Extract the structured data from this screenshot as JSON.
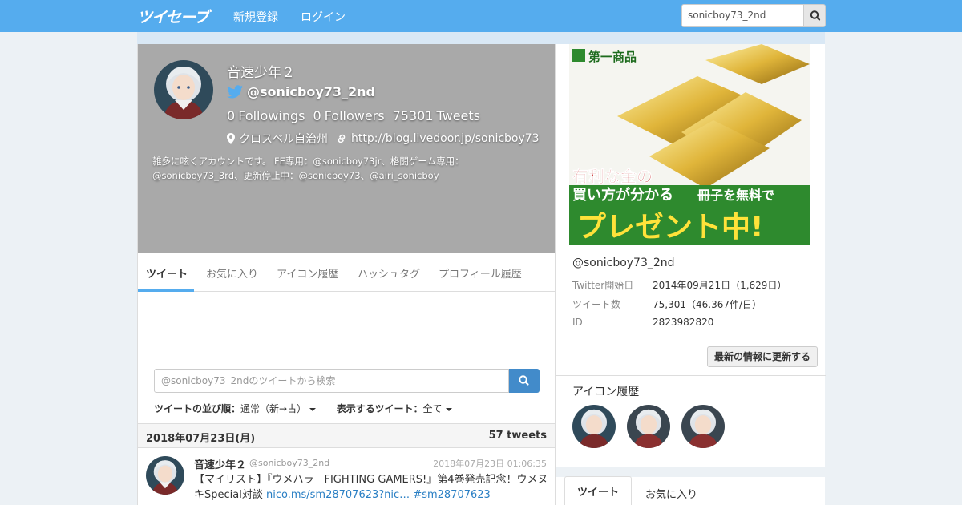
{
  "nav": {
    "logo": "ツイセーブ",
    "register": "新規登録",
    "login": "ログイン",
    "search_value": "sonicboy73_2nd"
  },
  "profile": {
    "name": "音速少年２",
    "handle": "@sonicboy73_2nd",
    "followings_count": "0",
    "followings_label": "Followings",
    "followers_count": "0",
    "followers_label": "Followers",
    "tweets_count": "75301",
    "tweets_label": "Tweets",
    "location": "クロスベル自治州",
    "url": "http://blog.livedoor.jp/sonicboy73",
    "bio": "雑多に呟くアカウントです。 FE専用：@sonicboy73jr、格闘ゲーム専用：@sonicboy73_3rd、更新停止中：@sonicboy73、@airi_sonicboy"
  },
  "tabs": [
    "ツイート",
    "お気に入り",
    "アイコン履歴",
    "ハッシュタグ",
    "プロフィール履歴"
  ],
  "tweet_search": {
    "placeholder": "@sonicboy73_2ndのツイートから検索"
  },
  "sort": {
    "order_label": "ツイートの並び順：",
    "order_value": "通常（新→古）",
    "show_label": "表示するツイート：",
    "show_value": "全て"
  },
  "day": {
    "date": "2018年07月23日(月)",
    "count": "57 tweets"
  },
  "tweet": {
    "name": "音速少年２",
    "handle": "@sonicboy73_2nd",
    "time": "2018年07月23日 01:06:35",
    "text": "【マイリスト】『ウメハラ　FIGHTING GAMERS!』第4巻発売記念！ウメヌキSpecial対談",
    "link": "nico.ms/sm28707623?nic…",
    "hashtag": "#sm28707623"
  },
  "ad": {
    "brand": "第一商品",
    "line1": "有利な金の",
    "line2": "買い方が分かる",
    "line3": "冊子を無料で",
    "line4": "プレゼント中!"
  },
  "sidebar": {
    "handle": "@sonicboy73_2nd",
    "start_label": "Twitter開始日",
    "start_value": "2014年09月21日（1,629日）",
    "tweets_label": "ツイート数",
    "tweets_value": "75,301（46.367件/日）",
    "id_label": "ID",
    "id_value": "2823982820",
    "update_button": "最新の情報に更新する",
    "icon_history_title": "アイコン履歴",
    "tab_tweets": "ツイート",
    "tab_favorites": "お気に入り"
  },
  "colors": {
    "nav": "#55acee",
    "accent": "#428bca",
    "header_bg": "#a9a9a9"
  }
}
